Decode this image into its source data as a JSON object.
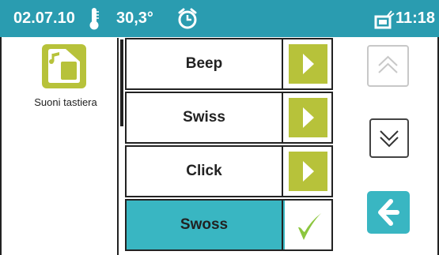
{
  "status_bar": {
    "date": "02.07.10",
    "temperature": "30,3°",
    "time": "11:18",
    "icons": [
      "thermometer-icon",
      "alarm-clock-icon",
      "message-icon"
    ],
    "background_color": "#2a9cb0"
  },
  "app": {
    "label": "Suoni tastiera",
    "icon": "music-note-icon",
    "tile_color": "#b7c23a"
  },
  "list": {
    "items": [
      {
        "label": "Beep",
        "action_icon": "play-icon",
        "selected": false
      },
      {
        "label": "Swiss",
        "action_icon": "play-icon",
        "selected": false
      },
      {
        "label": "Click",
        "action_icon": "play-icon",
        "selected": false
      },
      {
        "label": "Swoss",
        "action_icon": "checkmark-icon",
        "selected": true
      }
    ],
    "accent_color": "#b7c23a",
    "selected_color": "#39b6c2"
  },
  "navigation": {
    "scroll_up": {
      "icon": "chevron-up-icon",
      "enabled": false
    },
    "scroll_down": {
      "icon": "chevron-down-icon",
      "enabled": true
    },
    "back": {
      "icon": "arrow-left-icon",
      "color": "#39b6c2"
    }
  }
}
